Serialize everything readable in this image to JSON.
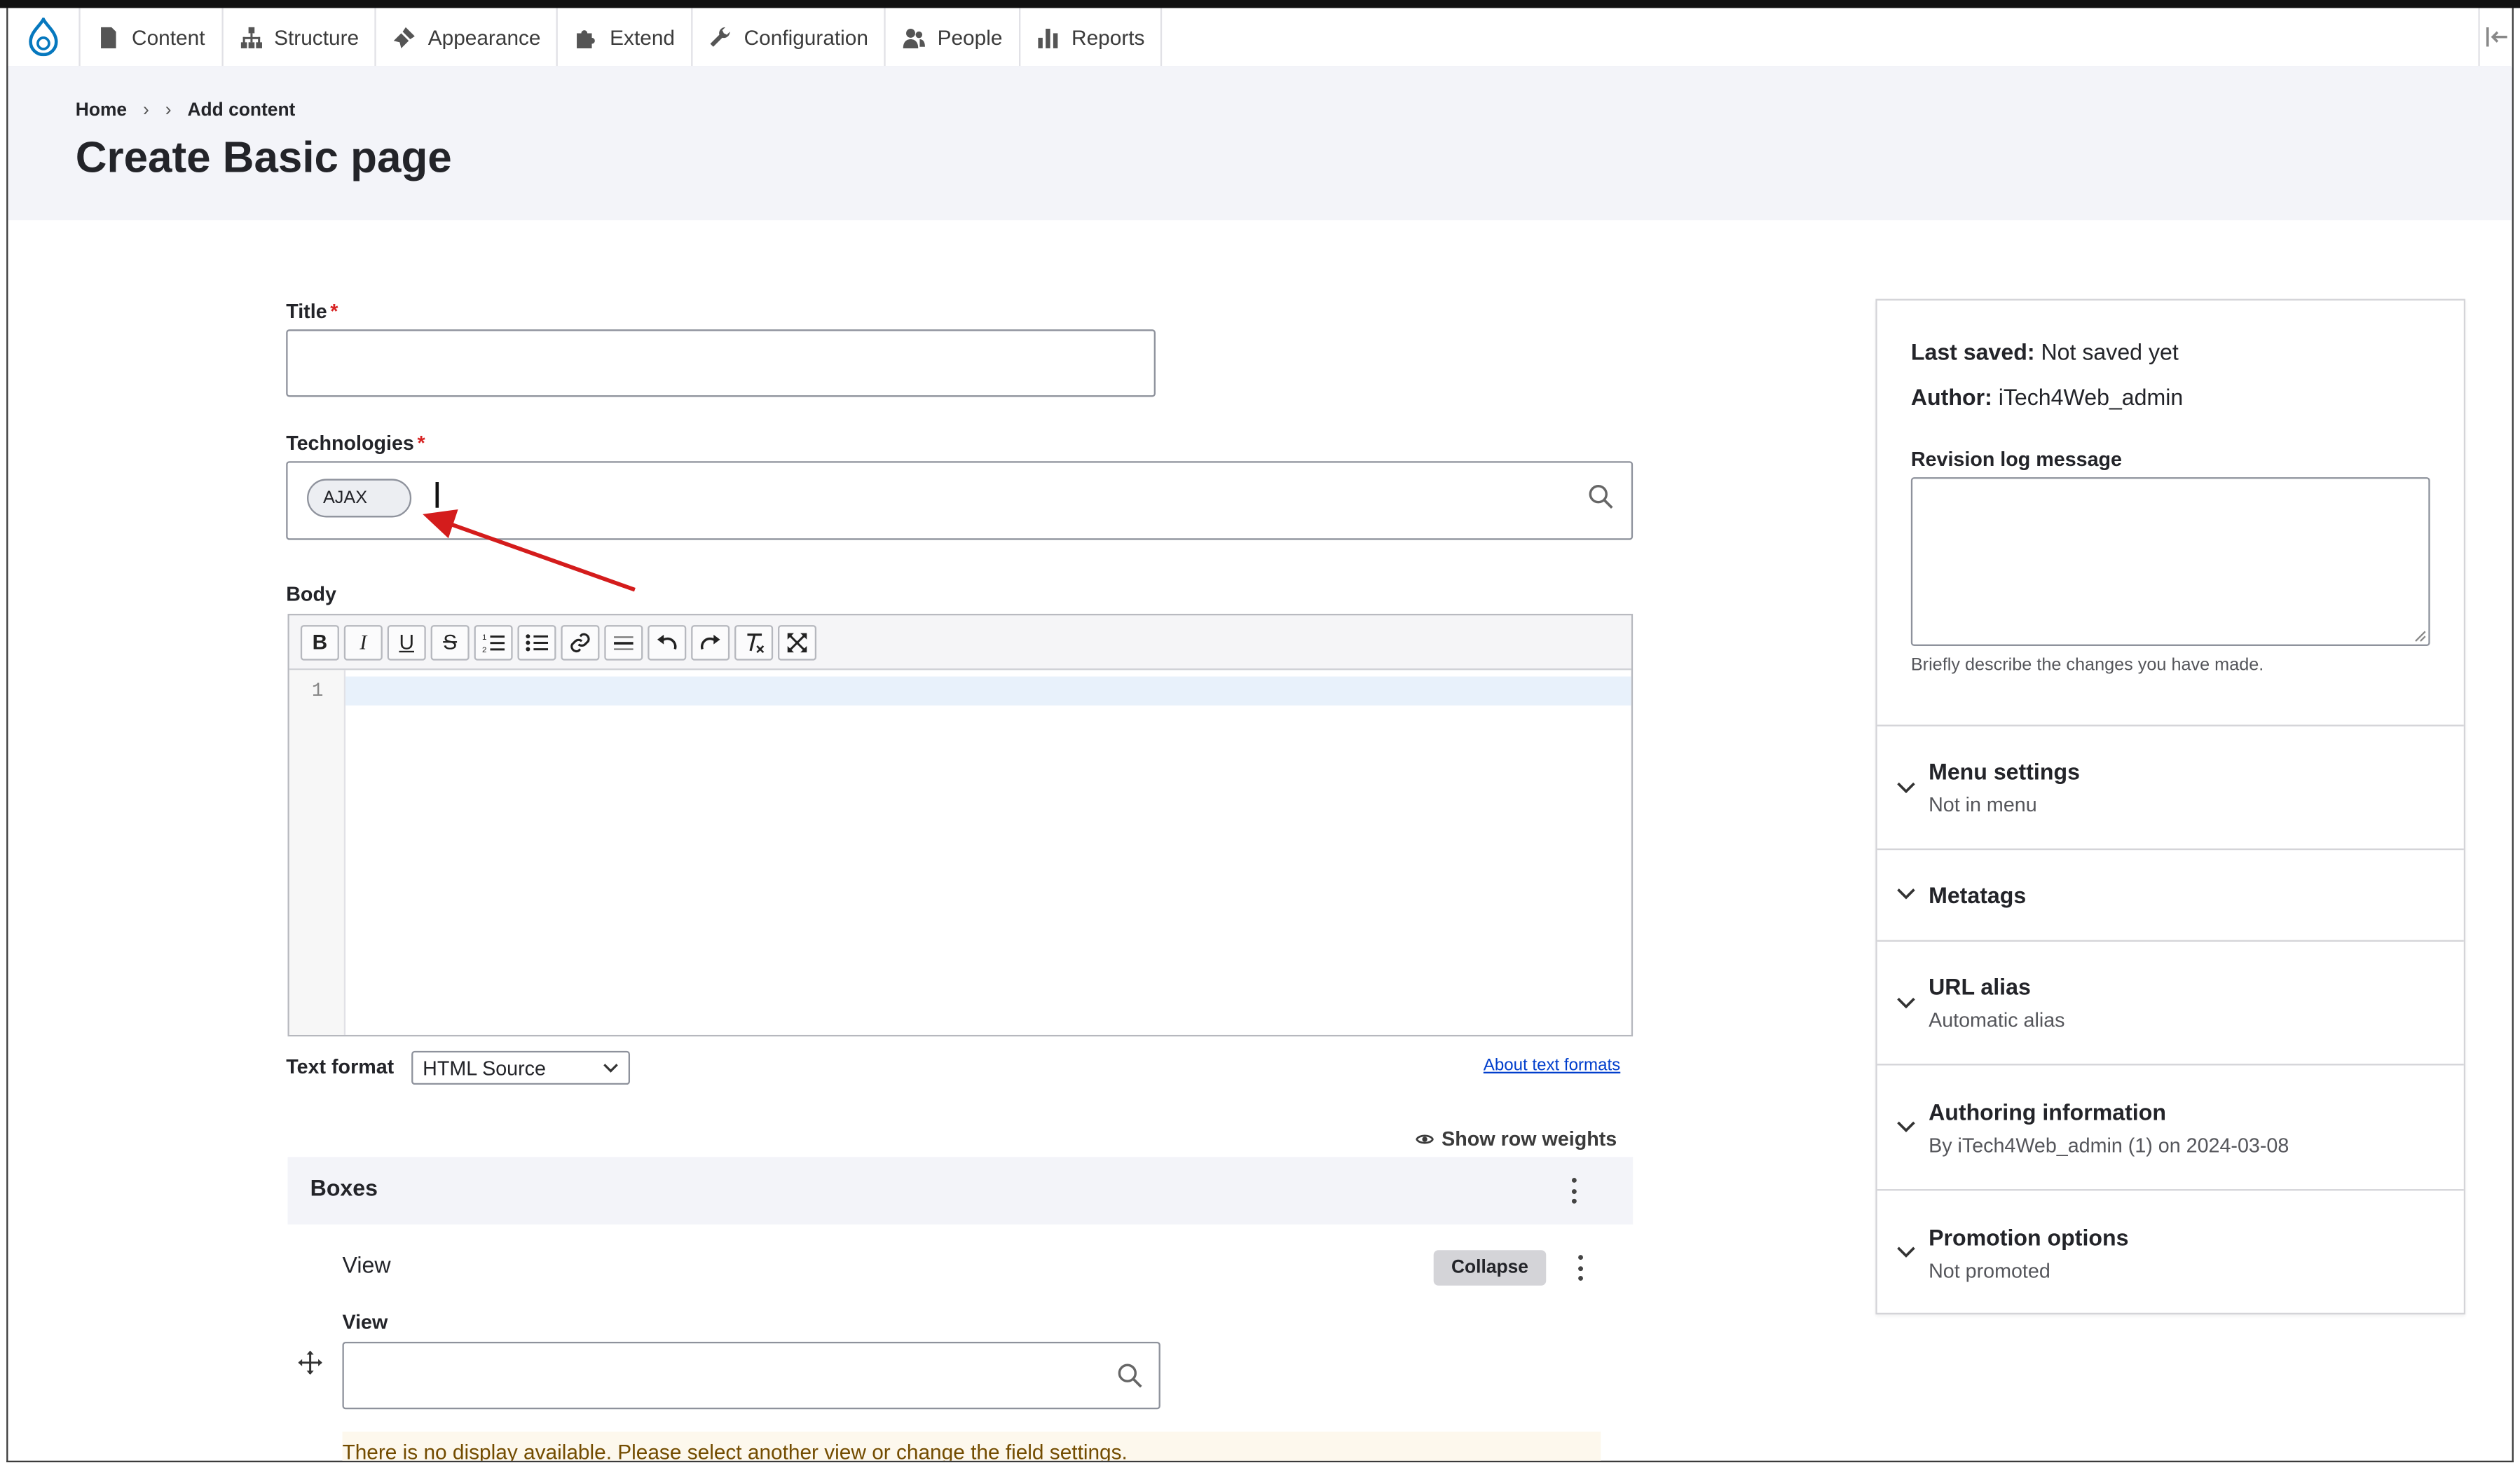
{
  "toolbar": {
    "items": [
      {
        "label": "Content",
        "icon": "page-icon"
      },
      {
        "label": "Structure",
        "icon": "sitemap-icon"
      },
      {
        "label": "Appearance",
        "icon": "brush-icon"
      },
      {
        "label": "Extend",
        "icon": "puzzle-icon"
      },
      {
        "label": "Configuration",
        "icon": "wrench-icon"
      },
      {
        "label": "People",
        "icon": "people-icon"
      },
      {
        "label": "Reports",
        "icon": "bar-chart-icon"
      }
    ]
  },
  "breadcrumb": {
    "home": "Home",
    "sep": "›",
    "current": "Add content"
  },
  "page": {
    "title": "Create Basic page"
  },
  "form": {
    "title_label": "Title",
    "title_value": "",
    "required_mark": "*",
    "tech_label": "Technologies",
    "tech_chip": "AJAX",
    "body_label": "Body",
    "line_number": "1",
    "text_format_label": "Text format",
    "text_format_value": "HTML Source",
    "about_formats": "About text formats",
    "show_row_weights": "Show row weights",
    "boxes_title": "Boxes",
    "view_item": "View",
    "collapse": "Collapse",
    "view_label": "View",
    "warning": "There is no display available. Please select another view or change the field settings."
  },
  "editor_buttons": [
    "B",
    "I",
    "U",
    "S"
  ],
  "sidebar": {
    "last_saved_label": "Last saved:",
    "last_saved_value": "Not saved yet",
    "author_label": "Author:",
    "author_value": "iTech4Web_admin",
    "revision_label": "Revision log message",
    "revision_hint": "Briefly describe the changes you have made.",
    "sections": [
      {
        "title": "Menu settings",
        "sub": "Not in menu"
      },
      {
        "title": "Metatags",
        "sub": ""
      },
      {
        "title": "URL alias",
        "sub": "Automatic alias"
      },
      {
        "title": "Authoring information",
        "sub": "By iTech4Web_admin (1) on 2024-03-08"
      },
      {
        "title": "Promotion options",
        "sub": "Not promoted"
      }
    ]
  },
  "colors": {
    "accent": "#003ecc",
    "required": "#d72222",
    "annotation_arrow": "#d41c1c",
    "drupal_blue": "#0678be"
  }
}
